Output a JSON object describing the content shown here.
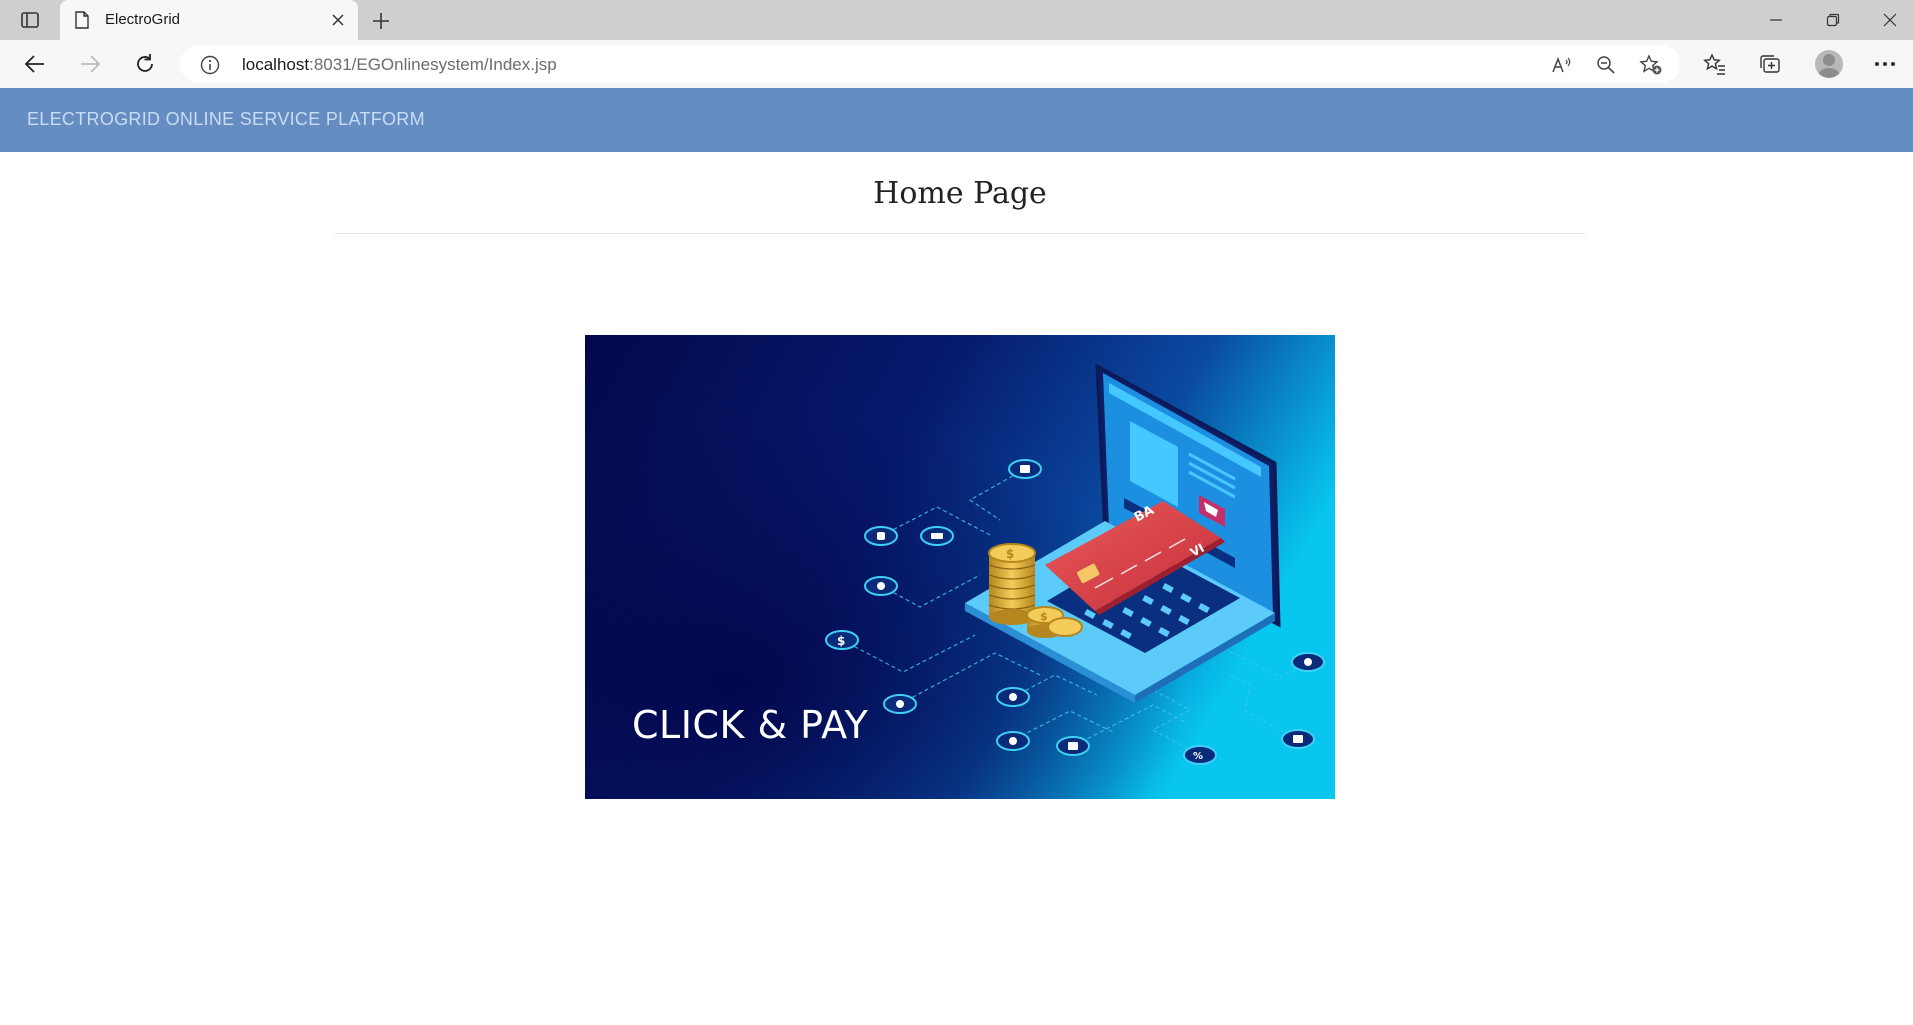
{
  "browser": {
    "tab_title": "ElectroGrid",
    "url_host": "localhost",
    "url_rest": ":8031/EGOnlinesystem/Index.jsp"
  },
  "header": {
    "brand": "ELECTROGRID ONLINE SERVICE PLATFORM",
    "background_color": "#668dc2"
  },
  "main": {
    "title": "Home Page",
    "banner": {
      "text": "CLICK & PAY",
      "card_text_1": "BA",
      "card_text_2": "VI"
    }
  },
  "icons": {
    "tab_actions": "tab-actions-icon",
    "favicon": "page-icon",
    "back": "back-arrow-icon",
    "forward": "forward-arrow-icon",
    "reload": "reload-icon",
    "site_info": "info-icon",
    "read_aloud": "read-aloud-icon",
    "zoom": "zoom-out-icon",
    "add_favorite": "add-favorite-icon",
    "favorites": "favorites-icon",
    "collections": "collections-icon",
    "profile": "avatar",
    "more": "more-icon"
  }
}
